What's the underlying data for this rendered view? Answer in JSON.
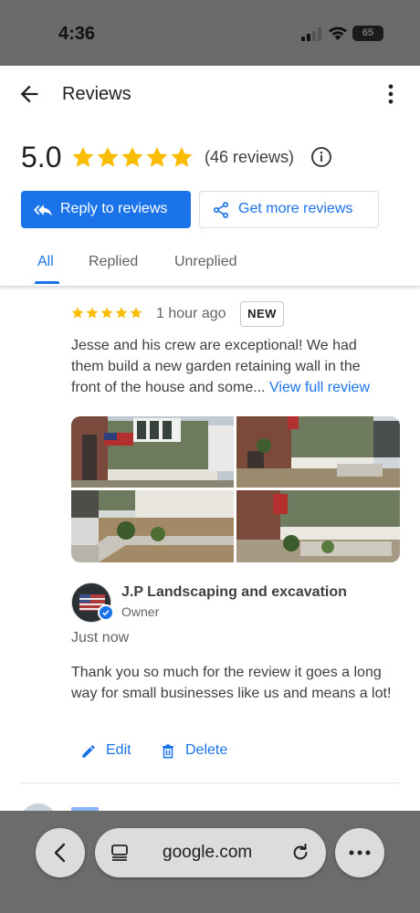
{
  "status_bar": {
    "time": "4:36",
    "battery": "65"
  },
  "header": {
    "title": "Reviews"
  },
  "summary": {
    "rating": "5.0",
    "stars": 5,
    "review_count": "(46 reviews)"
  },
  "actions": {
    "reply_label": "Reply to reviews",
    "get_more_label": "Get more reviews"
  },
  "tabs": [
    {
      "label": "All",
      "active": true
    },
    {
      "label": "Replied",
      "active": false
    },
    {
      "label": "Unreplied",
      "active": false
    }
  ],
  "review": {
    "stars": 5,
    "time": "1 hour ago",
    "badge": "NEW",
    "text": "Jesse and his crew are exceptional! We had them build a new garden retaining wall in the front of the house and some...",
    "view_full": "View full review",
    "photo_count": 4
  },
  "owner_reply": {
    "name": "J.P Landscaping and excavation",
    "role": "Owner",
    "time": "Just now",
    "text": "Thank you so much for the review it goes a long way for small businesses like us and means a lot!",
    "edit_label": "Edit",
    "delete_label": "Delete"
  },
  "browser": {
    "url": "google.com"
  },
  "colors": {
    "accent": "#1a73e8",
    "star": "#fbbc04"
  }
}
